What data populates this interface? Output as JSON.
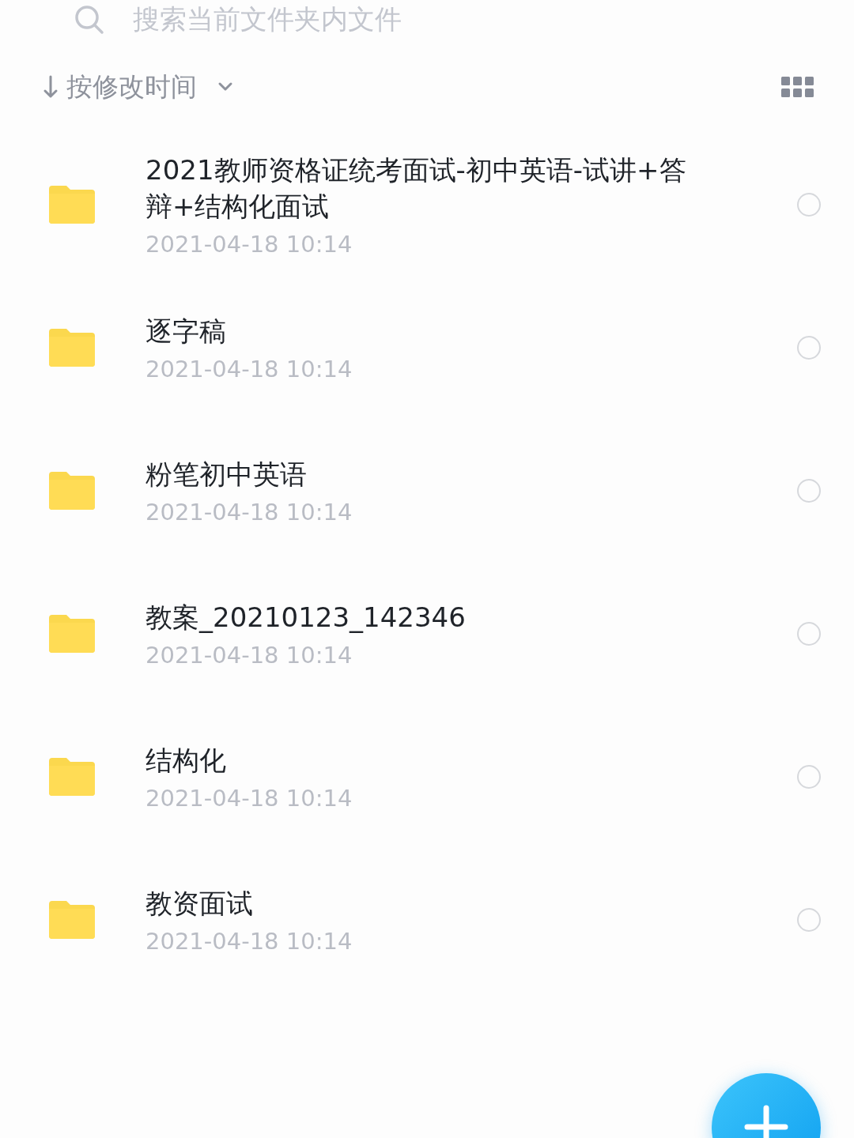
{
  "search": {
    "placeholder": "搜索当前文件夹内文件"
  },
  "sort": {
    "label": "按修改时间"
  },
  "files": [
    {
      "name": "2021教师资格证统考面试-初中英语-试讲+答辩+结构化面试",
      "date": "2021-04-18 10:14",
      "selected": false
    },
    {
      "name": "逐字稿",
      "date": "2021-04-18 10:14",
      "selected": false
    },
    {
      "name": "粉笔初中英语",
      "date": "2021-04-18 10:14",
      "selected": false
    },
    {
      "name": "教案_20210123_142346",
      "date": "2021-04-18 10:14",
      "selected": false
    },
    {
      "name": "结构化",
      "date": "2021-04-18 10:14",
      "selected": false
    },
    {
      "name": "教资面试",
      "date": "2021-04-18 10:14",
      "selected": false
    }
  ]
}
